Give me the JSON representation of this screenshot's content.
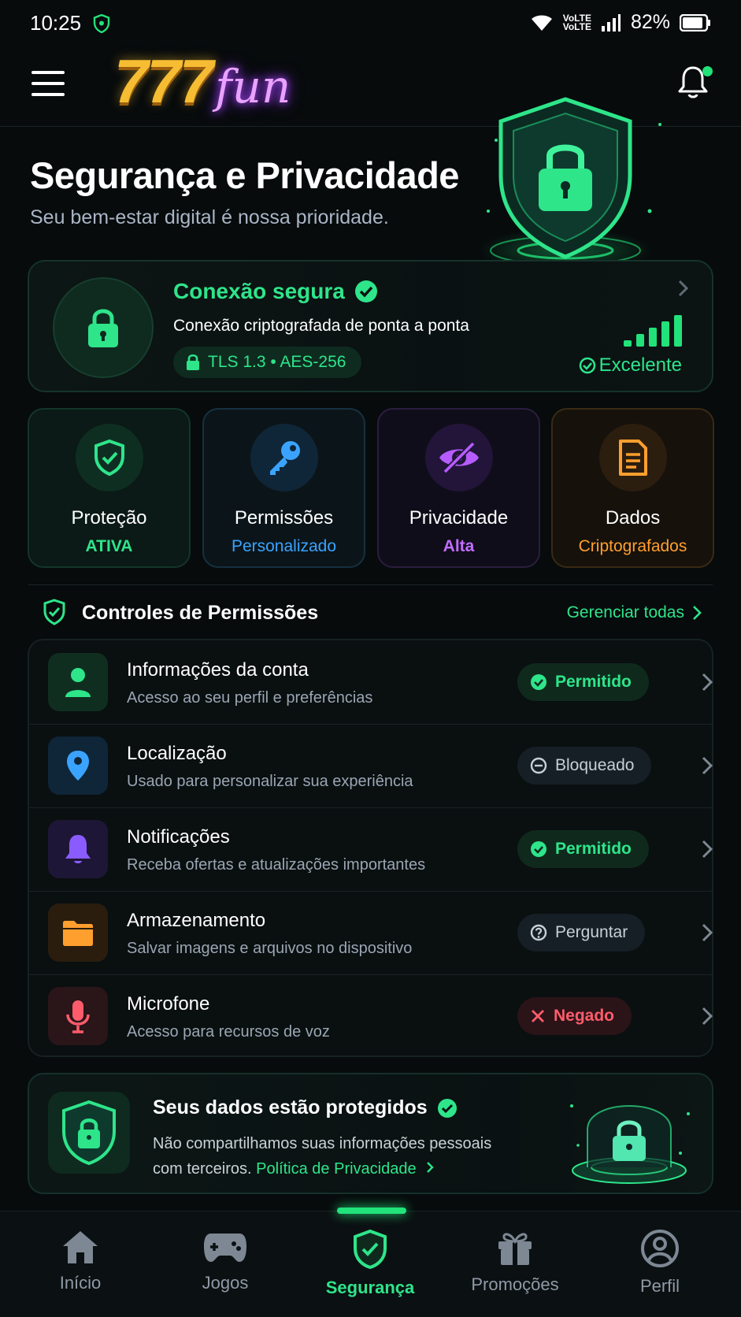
{
  "status_bar": {
    "time": "10:25",
    "network": "VoLTE",
    "battery": "82%"
  },
  "header": {
    "logo_number": "777",
    "logo_word": "fun"
  },
  "hero": {
    "title": "Segurança e Privacidade",
    "subtitle": "Seu bem-estar digital é nossa prioridade."
  },
  "connection": {
    "title": "Conexão segura",
    "description": "Conexão criptografada de ponta a ponta",
    "protocol": "TLS 1.3 • AES-256",
    "quality": "Excelente",
    "signal_bars": 5
  },
  "tiles": [
    {
      "label": "Proteção",
      "value": "ATIVA",
      "icon": "shield-check-icon",
      "color": "#2ee58a"
    },
    {
      "label": "Permissões",
      "value": "Personalizado",
      "icon": "key-icon",
      "color": "#3aa3ff"
    },
    {
      "label": "Privacidade",
      "value": "Alta",
      "icon": "eye-off-icon",
      "color": "#b65cff"
    },
    {
      "label": "Dados",
      "value": "Criptografados",
      "icon": "document-icon",
      "color": "#ff9f2e"
    }
  ],
  "permissions": {
    "title": "Controles de Permissões",
    "manage_label": "Gerenciar todas",
    "items": [
      {
        "name": "Informações da conta",
        "desc": "Acesso ao seu perfil e preferências",
        "status": "Permitido",
        "icon": "user-icon"
      },
      {
        "name": "Localização",
        "desc": "Usado para personalizar sua experiência",
        "status": "Bloqueado",
        "icon": "location-pin-icon"
      },
      {
        "name": "Notificações",
        "desc": "Receba ofertas e atualizações importantes",
        "status": "Permitido",
        "icon": "bell-icon"
      },
      {
        "name": "Armazenamento",
        "desc": "Salvar imagens e arquivos no dispositivo",
        "status": "Perguntar",
        "icon": "folder-icon"
      },
      {
        "name": "Microfone",
        "desc": "Acesso para recursos de voz",
        "status": "Negado",
        "icon": "microphone-icon"
      }
    ]
  },
  "protected": {
    "title": "Seus dados estão protegidos",
    "line1": "Não compartilhamos suas informações pessoais",
    "line2_prefix": "com terceiros.",
    "link": "Política de Privacidade"
  },
  "nav": [
    {
      "label": "Início",
      "icon": "home-icon",
      "active": false
    },
    {
      "label": "Jogos",
      "icon": "gamepad-icon",
      "active": false
    },
    {
      "label": "Segurança",
      "icon": "shield-check-icon",
      "active": true
    },
    {
      "label": "Promoções",
      "icon": "gift-icon",
      "active": false
    },
    {
      "label": "Perfil",
      "icon": "user-circle-icon",
      "active": false
    }
  ],
  "colors": {
    "accent_green": "#2ee58a",
    "background": "#070b0c",
    "blue": "#3aa3ff",
    "purple": "#b65cff",
    "orange": "#ff9f2e",
    "red": "#ff5c6b"
  }
}
